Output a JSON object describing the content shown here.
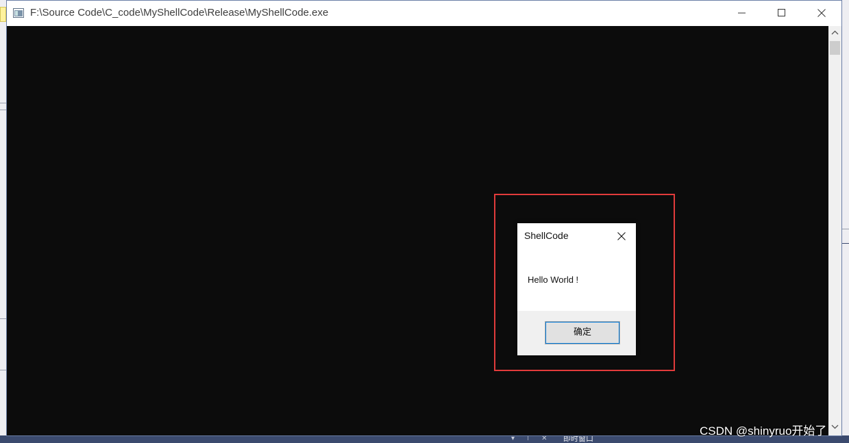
{
  "window": {
    "title": "F:\\Source Code\\C_code\\MyShellCode\\Release\\MyShellCode.exe",
    "icon": "console-app-icon"
  },
  "message_box": {
    "title": "ShellCode",
    "text": "Hello World !",
    "ok_label": "确定",
    "close_icon": "close-icon"
  },
  "background_ide": {
    "bottom_panel_label": "即时窗口",
    "bottom_panel_controls": "▾ ⊤ ✕"
  },
  "watermark": "CSDN @shinyruo开始了",
  "colors": {
    "console_bg": "#0c0c0c",
    "highlight_border": "#e23b3b",
    "dialog_footer": "#f0f0f0",
    "button_focus": "#0078d7"
  }
}
